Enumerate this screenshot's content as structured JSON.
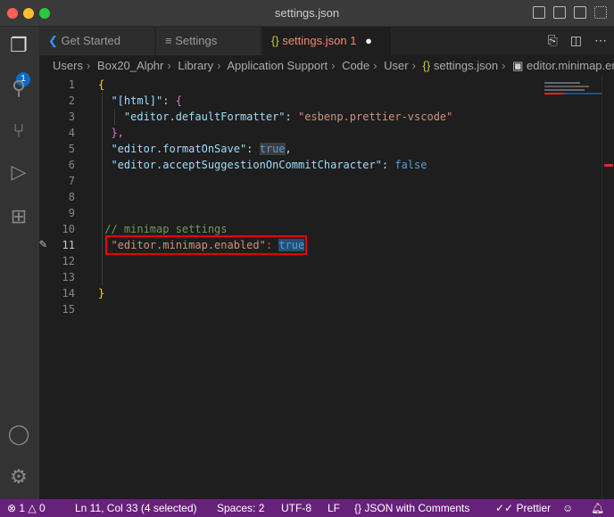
{
  "window": {
    "title": "settings.json"
  },
  "activity": {
    "explorer_badge": "1"
  },
  "tabs": [
    {
      "label": "Get Started"
    },
    {
      "label": "Settings"
    },
    {
      "label": "settings.json",
      "problems": "1"
    }
  ],
  "breadcrumb": [
    "Users",
    "Box20_Alphr",
    "Library",
    "Application Support",
    "Code",
    "User",
    "settings.json",
    "editor.minimap.enabled"
  ],
  "editor": {
    "line_numbers": [
      "1",
      "2",
      "3",
      "4",
      "5",
      "6",
      "7",
      "8",
      "9",
      "10",
      "11",
      "12",
      "13",
      "14",
      "15"
    ],
    "lines": {
      "l1": "{",
      "l2k": "\"[html]\"",
      "l2b": "{",
      "l3k": "\"editor.defaultFormatter\"",
      "l3v": "\"esbenp.prettier-vscode\"",
      "l4": "},",
      "l5k": "\"editor.formatOnSave\"",
      "l5v": "true",
      "l6k": "\"editor.acceptSuggestionOnCommitCharacter\"",
      "l6v": "false",
      "l10": "// minimap settings",
      "l11k": "\"editor.minimap.enabled\"",
      "l11v": "true",
      "l14": "}"
    }
  },
  "status": {
    "errors": "1",
    "warnings": "0",
    "position": "Ln 11, Col 33 (4 selected)",
    "spaces": "Spaces: 2",
    "encoding": "UTF-8",
    "eol": "LF",
    "language": "JSON with Comments",
    "formatter": "Prettier"
  },
  "colors": {
    "status_bar": "#68217a",
    "highlight_box": "#ee0000"
  }
}
